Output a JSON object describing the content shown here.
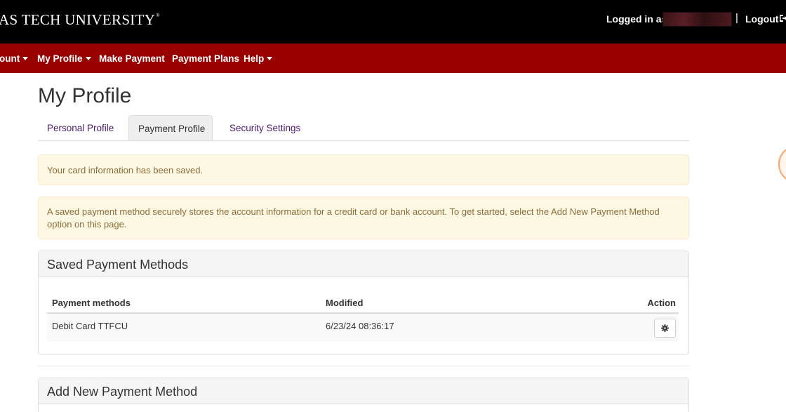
{
  "header": {
    "brand": "AS TECH UNIVERSITY",
    "brand_mark": "®",
    "logged_in_label": "Logged in as:",
    "separator": "|",
    "logout_label": "Logout",
    "logout_icon": "logout-icon"
  },
  "nav": {
    "items": [
      {
        "label": "ount",
        "has_caret": true
      },
      {
        "label": "My Profile",
        "has_caret": true
      },
      {
        "label": "Make Payment",
        "has_caret": false
      },
      {
        "label": "Payment Plans",
        "has_caret": false
      },
      {
        "label": "Help",
        "has_caret": true
      }
    ]
  },
  "page": {
    "title": "My Profile",
    "tabs": [
      {
        "label": "Personal Profile",
        "active": false
      },
      {
        "label": "Payment Profile",
        "active": true
      },
      {
        "label": "Security Settings",
        "active": false
      }
    ]
  },
  "alerts": {
    "saved": "Your card information has been saved.",
    "info": "A saved payment method securely stores the account information for a credit card or bank account. To get started, select the Add New Payment Method option on this page."
  },
  "saved_methods": {
    "heading": "Saved Payment Methods",
    "columns": [
      "Payment methods",
      "Modified",
      "Action"
    ],
    "rows": [
      {
        "method": "Debit Card TTFCU",
        "modified": "6/23/24 08:36:17",
        "action_icon": "gear-icon"
      }
    ]
  },
  "add_method": {
    "heading": "Add New Payment Method"
  },
  "colors": {
    "topbar": "#000000",
    "navbar": "#990000",
    "tab_link": "#4b1a68",
    "alert_bg": "#fcf8e3",
    "alert_text": "#8a6d3b"
  }
}
